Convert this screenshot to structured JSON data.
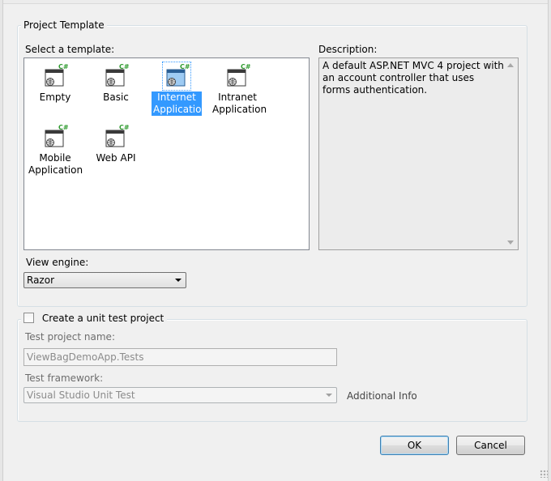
{
  "project_template": {
    "group_title": "Project Template",
    "select_label": "Select a template:",
    "templates": [
      {
        "label": "Empty",
        "selected": false
      },
      {
        "label": "Basic",
        "selected": false
      },
      {
        "label": "Internet Application",
        "selected": true
      },
      {
        "label": "Intranet Application",
        "selected": false
      },
      {
        "label": "Mobile Application",
        "selected": false
      },
      {
        "label": "Web API",
        "selected": false
      }
    ],
    "icon_badge": "C#",
    "description_label": "Description:",
    "description_text": "A default ASP.NET MVC 4 project with an account controller that uses forms authentication.",
    "view_engine_label": "View engine:",
    "view_engine_value": "Razor"
  },
  "unit_test": {
    "checkbox_label": "Create a unit test project",
    "checked": false,
    "test_project_name_label": "Test project name:",
    "test_project_name_value": "ViewBagDemoApp.Tests",
    "test_framework_label": "Test framework:",
    "test_framework_value": "Visual Studio Unit Test",
    "additional_info_label": "Additional Info"
  },
  "buttons": {
    "ok_label": "OK",
    "cancel_label": "Cancel"
  },
  "colors": {
    "selection": "#3399ff",
    "badge_green": "#2e9a2e"
  }
}
